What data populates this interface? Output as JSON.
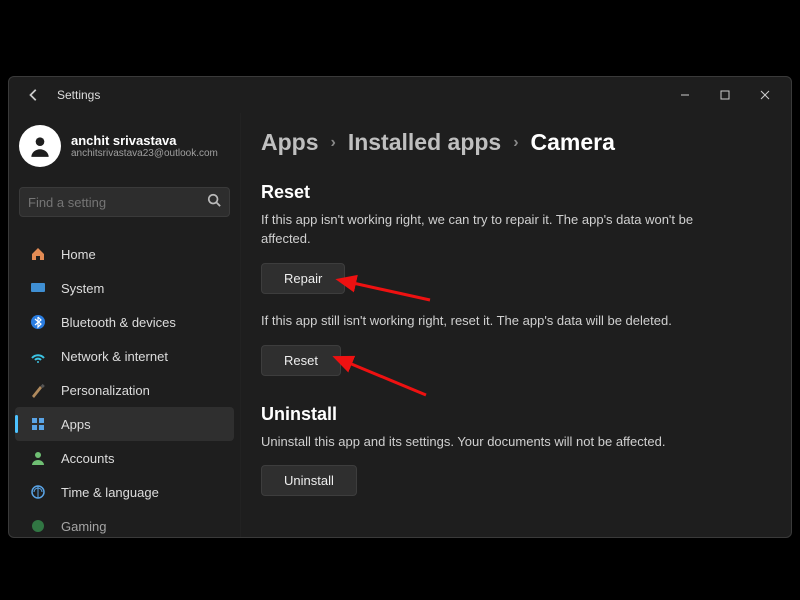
{
  "window": {
    "title": "Settings"
  },
  "user": {
    "name": "anchit srivastava",
    "email": "anchitsrivastava23@outlook.com"
  },
  "search": {
    "placeholder": "Find a setting"
  },
  "nav": {
    "home": "Home",
    "system": "System",
    "bluetooth": "Bluetooth & devices",
    "network": "Network & internet",
    "personalization": "Personalization",
    "apps": "Apps",
    "accounts": "Accounts",
    "time": "Time & language",
    "gaming": "Gaming"
  },
  "breadcrumb": {
    "apps": "Apps",
    "installed": "Installed apps",
    "current": "Camera"
  },
  "sections": {
    "reset": {
      "heading": "Reset",
      "repair_help": "If this app isn't working right, we can try to repair it. The app's data won't be affected.",
      "repair_btn": "Repair",
      "reset_help": "If this app still isn't working right, reset it. The app's data will be deleted.",
      "reset_btn": "Reset"
    },
    "uninstall": {
      "heading": "Uninstall",
      "help": "Uninstall this app and its settings. Your documents will not be affected.",
      "btn": "Uninstall"
    }
  }
}
